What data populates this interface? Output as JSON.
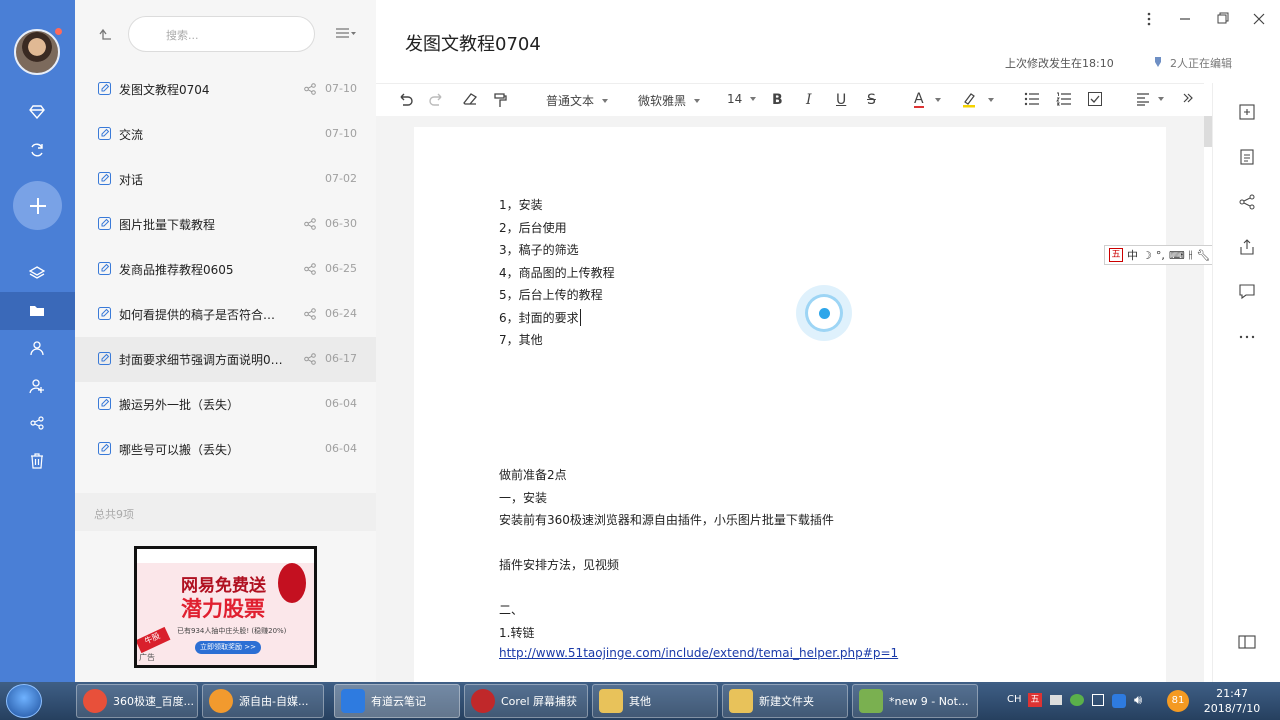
{
  "note": {
    "title": "发图文教程0704",
    "last_modified": "上次修改发生在18:10",
    "editing": "2人正在编辑"
  },
  "search": {
    "placeholder": "搜索..."
  },
  "notes": [
    {
      "title": "发图文教程0704",
      "date": "07-10",
      "shared": true
    },
    {
      "title": "交流",
      "date": "07-10",
      "shared": false
    },
    {
      "title": "对话",
      "date": "07-02",
      "shared": false
    },
    {
      "title": "图片批量下载教程",
      "date": "06-30",
      "shared": true
    },
    {
      "title": "发商品推荐教程0605",
      "date": "06-25",
      "shared": true
    },
    {
      "title": "如何看提供的稿子是否符合要...",
      "date": "06-24",
      "shared": true
    },
    {
      "title": "封面要求细节强调方面说明0617",
      "date": "06-17",
      "shared": true
    },
    {
      "title": "搬运另外一批（丢失）",
      "date": "06-04",
      "shared": false
    },
    {
      "title": "哪些号可以搬（丢失）",
      "date": "06-04",
      "shared": false
    }
  ],
  "total": "总共9项",
  "ad": {
    "headline": "网易免费送",
    "subline": "潜力股票",
    "detail": "已有934人抽中庄头股! (稳赚20%)",
    "cta": "立即领取奖励 >>",
    "tag": "牛股",
    "label": "广告"
  },
  "toolbar": {
    "style": "普通文本",
    "font": "微软雅黑",
    "size": "14",
    "bold": "B",
    "italic": "I",
    "underline": "U",
    "strike": "S",
    "color": "A"
  },
  "content": {
    "lines": [
      "1，安装",
      "2，后台使用",
      "3，稿子的筛选",
      "4，商品图的上传教程",
      "5，后台上传的教程",
      "6，封面的要求",
      "7，其他"
    ],
    "prep_title": "做前准备2点",
    "prep_1": "一，安装",
    "prep_1_text": "安装前有360极速浏览器和源自由插件，小乐图片批量下载插件",
    "prep_1_method": "插件安排方法，见视频",
    "prep_2": "二、",
    "prep_2_sub": "1.转链",
    "link": "http://www.51taojinge.com/include/extend/temai_helper.php#p=1"
  },
  "ime": {
    "mode": "中"
  },
  "taskbar": {
    "items": [
      {
        "label": "360极速_百度...",
        "color": "#e8503a"
      },
      {
        "label": "源自由-自媒...",
        "color": "#f29a2e"
      },
      {
        "label": "有道云笔记",
        "color": "#2e7be0"
      },
      {
        "label": "Corel 屏幕捕获",
        "color": "#c0282a"
      },
      {
        "label": "其他",
        "color": "#e8c25a"
      },
      {
        "label": "新建文件夹",
        "color": "#e8c25a"
      },
      {
        "label": "*new 9 - Not...",
        "color": "#7ab050"
      }
    ],
    "lang": "CH",
    "badge": "81",
    "time": "21:47",
    "date": "2018/7/10"
  },
  "colors": {
    "rail": "#4a7fd6",
    "accent": "#2ea6ea",
    "link": "#1a3aa8"
  }
}
